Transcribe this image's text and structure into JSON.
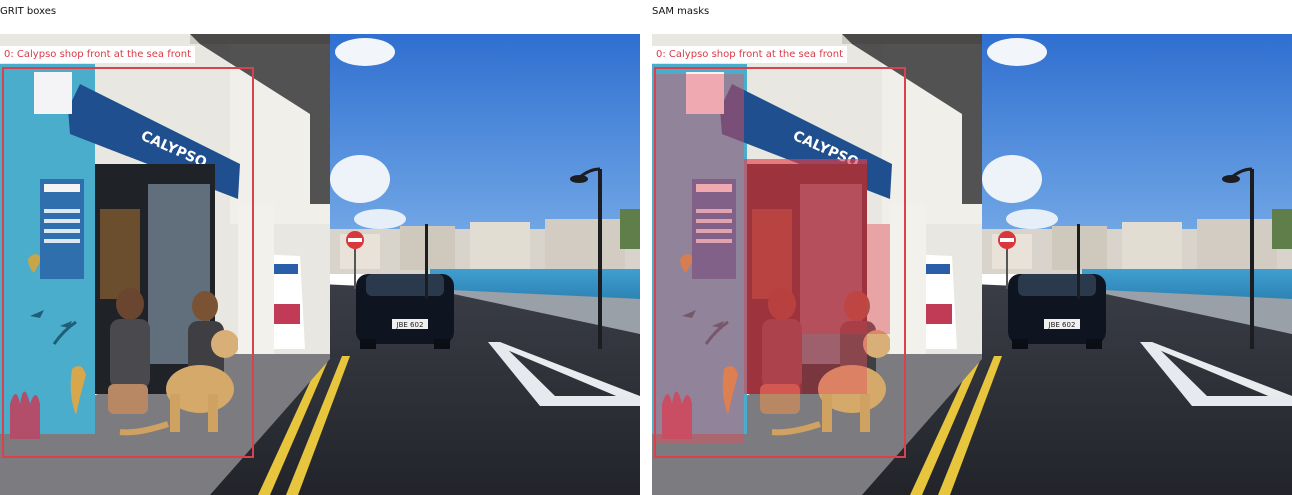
{
  "panels": {
    "left": {
      "title": "GRIT boxes",
      "label": "0: Calypso shop front at the sea front"
    },
    "right": {
      "title": "SAM masks",
      "label": "0: Calypso shop front at the sea front"
    }
  },
  "scene": {
    "sign_text": "CALYPSO",
    "car_plate": "JBE 602"
  },
  "colors": {
    "annotation": "#d9414c",
    "mask_fill": "rgba(230, 80, 90, 0.45)",
    "sky": "#4a86d8"
  },
  "icons": [
    "no-entry-sign-icon",
    "street-lamp-icon"
  ]
}
